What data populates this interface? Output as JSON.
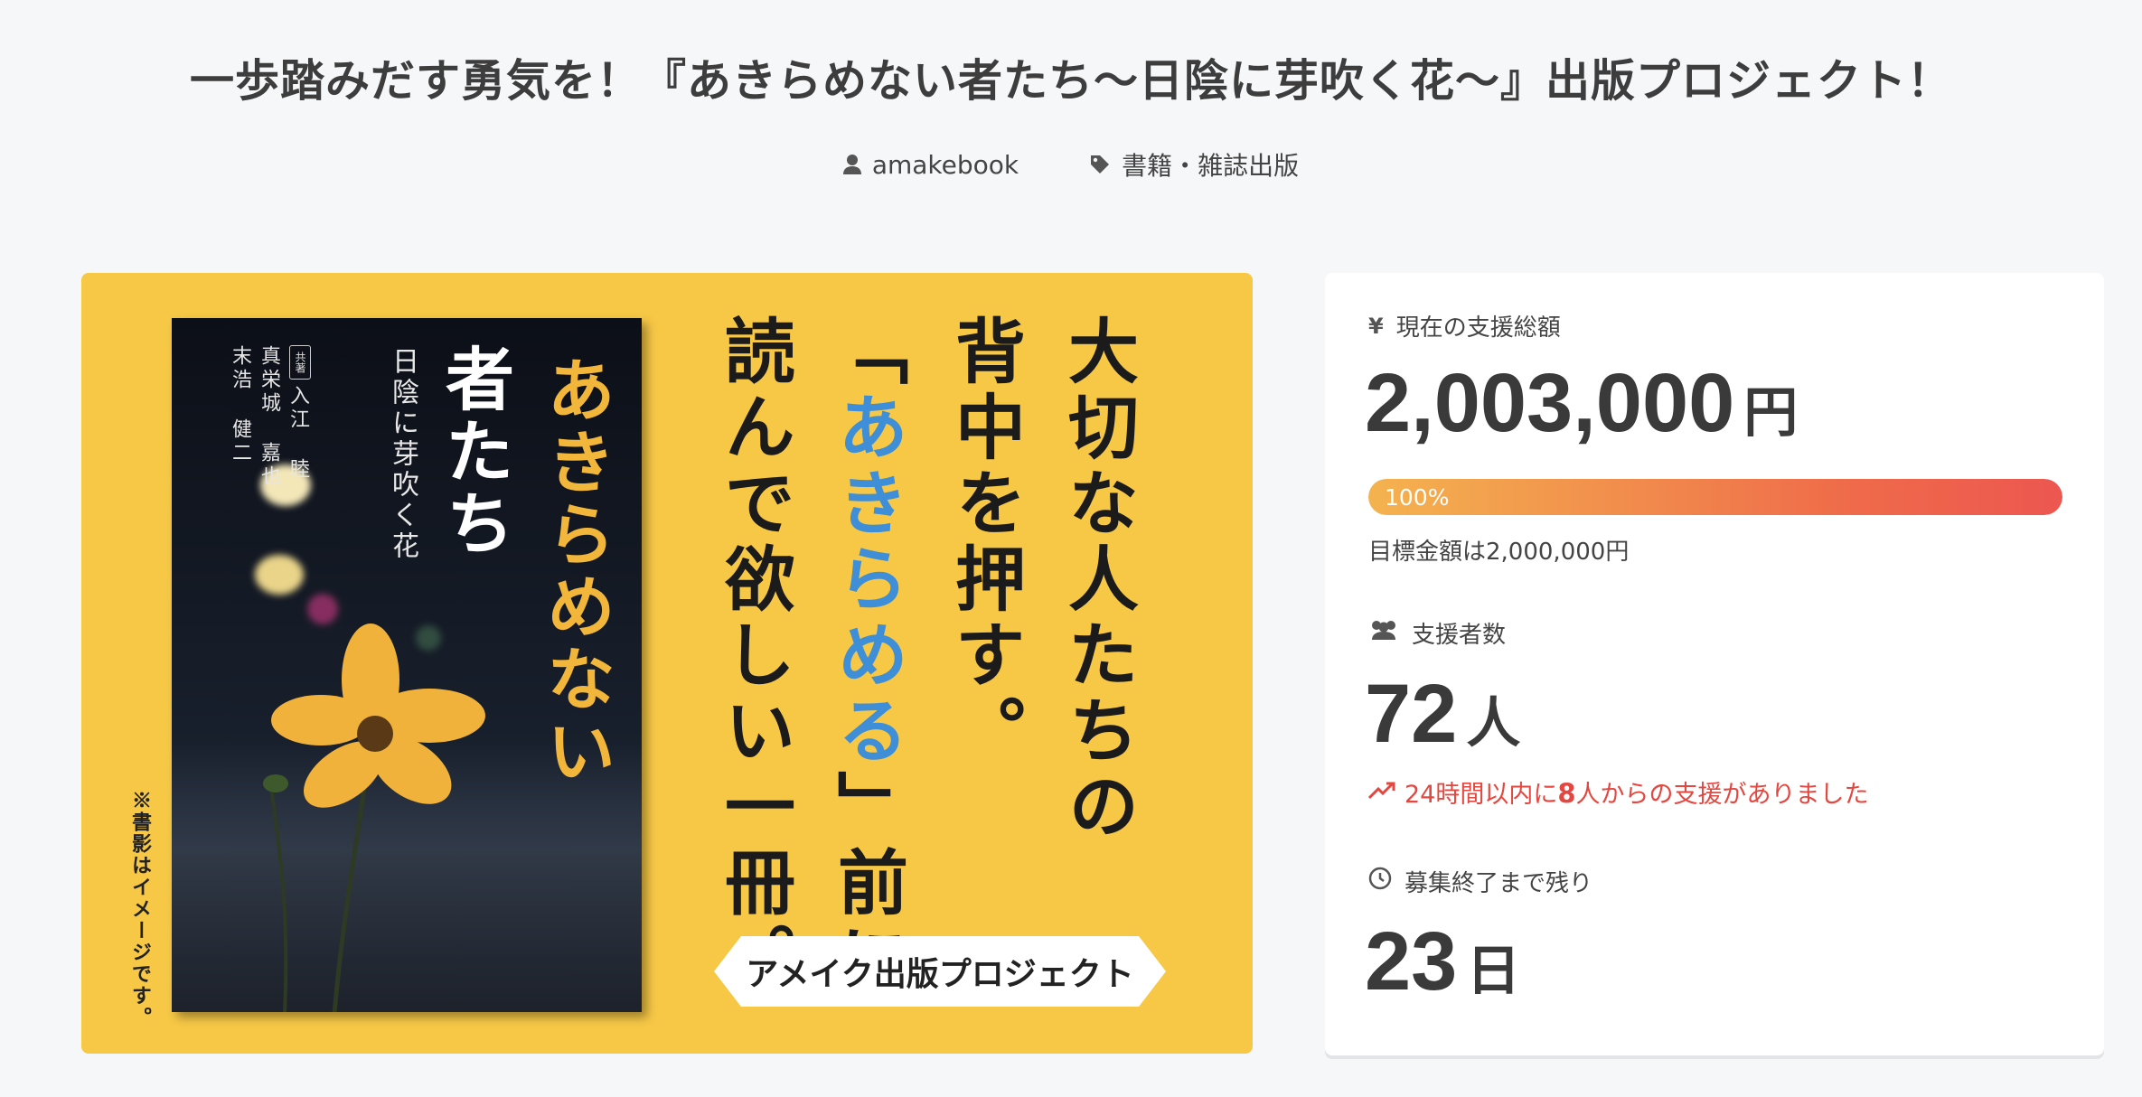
{
  "header": {
    "title": "一歩踏みだす勇気を！『あきらめない者たち〜日陰に芽吹く花〜』出版プロジェクト！",
    "author": "amakebook",
    "category": "書籍・雑誌出版"
  },
  "hero": {
    "book": {
      "title_a": "あきらめない",
      "title_b": "者たち",
      "subtitle": "日陰に芽吹く花",
      "badge": "共著",
      "author1": "入江 睦",
      "author2": "真栄城 嘉也",
      "author3": "末浩 健二"
    },
    "note": "※書影はイメージです。",
    "copy_lines": [
      "大切な人たちの",
      "背中を押す。",
      "「あきらめる」前に",
      "読んで欲しい一冊。"
    ],
    "copy_line3_pre": "「",
    "copy_line3_blue": "あきらめる",
    "copy_line3_post": "」前に",
    "stamp": "アメイク出版プロジェクト"
  },
  "stats": {
    "amount_label": "現在の支援総額",
    "amount_value": "2,003,000",
    "amount_unit": "円",
    "progress_text": "100%",
    "progress_percent": 100,
    "goal_text": "目標金額は2,000,000円",
    "supporters_label": "支援者数",
    "supporters_value": "72",
    "supporters_unit": "人",
    "trend_pre": "24時間以内に",
    "trend_num": "8",
    "trend_post": "人からの支援がありました",
    "remaining_label": "募集終了まで残り",
    "remaining_value": "23",
    "remaining_unit": "日"
  },
  "icons": {
    "author": "user-icon",
    "category": "tag-icon",
    "amount": "yen-icon",
    "supporters": "users-icon",
    "trend": "trending-up-icon",
    "remaining": "clock-icon"
  },
  "colors": {
    "hero_bg": "#f7c846",
    "accent_blue": "#3e8fd8",
    "trend_red": "#e4473f",
    "progress_start": "#f4b34f",
    "progress_end": "#ec5750"
  }
}
